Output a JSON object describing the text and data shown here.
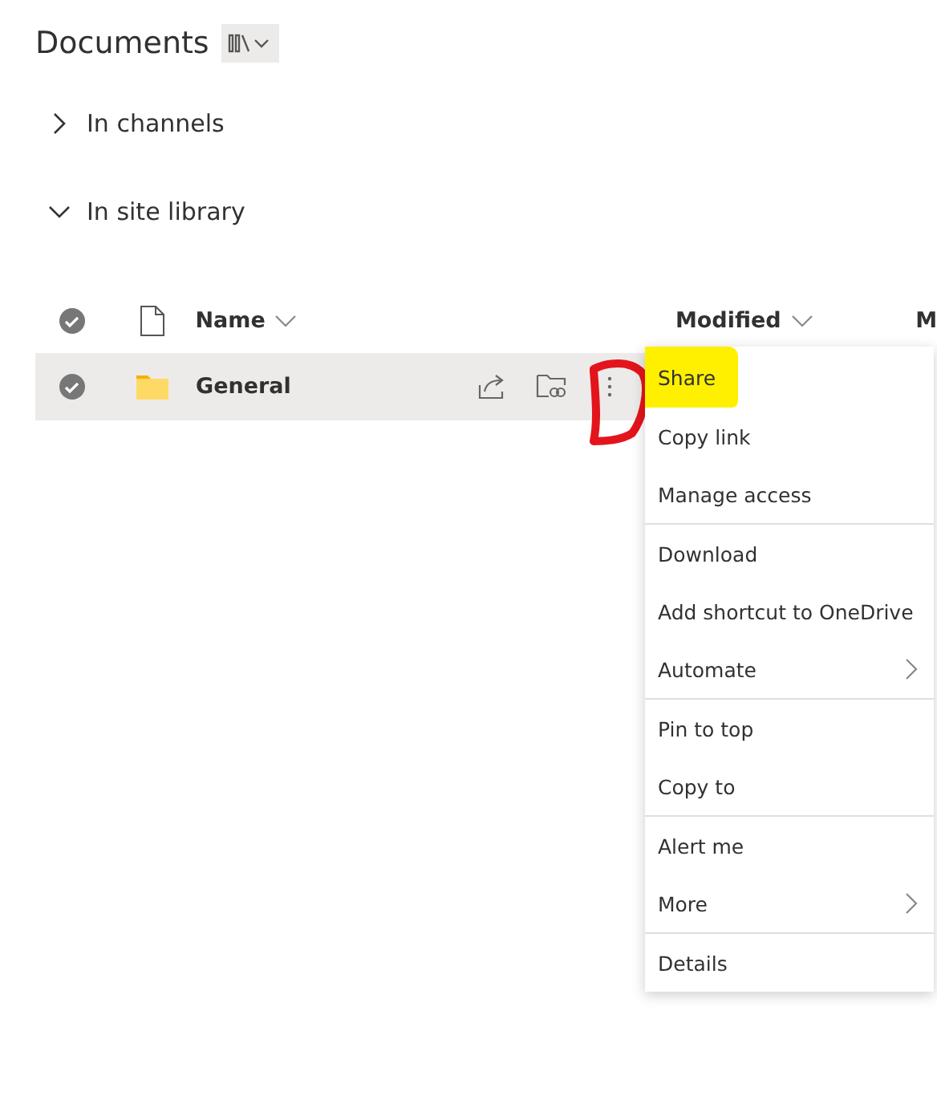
{
  "title": "Documents",
  "sections": [
    {
      "label": "In channels",
      "expanded": false
    },
    {
      "label": "In site library",
      "expanded": true
    }
  ],
  "table": {
    "columns": [
      "Name",
      "Modified",
      "M"
    ],
    "rows": [
      {
        "name": "General",
        "kind": "folder"
      }
    ]
  },
  "context_menu": {
    "groups": [
      [
        {
          "label": "Share",
          "has_submenu": false,
          "highlighted": true
        },
        {
          "label": "Copy link",
          "has_submenu": false,
          "highlighted": false
        },
        {
          "label": "Manage access",
          "has_submenu": false,
          "highlighted": false
        }
      ],
      [
        {
          "label": "Download",
          "has_submenu": false,
          "highlighted": false
        },
        {
          "label": "Add shortcut to OneDrive",
          "has_submenu": false,
          "highlighted": false
        },
        {
          "label": "Automate",
          "has_submenu": true,
          "highlighted": false
        }
      ],
      [
        {
          "label": "Pin to top",
          "has_submenu": false,
          "highlighted": false
        },
        {
          "label": "Copy to",
          "has_submenu": false,
          "highlighted": false
        }
      ],
      [
        {
          "label": "Alert me",
          "has_submenu": false,
          "highlighted": false
        },
        {
          "label": "More",
          "has_submenu": true,
          "highlighted": false
        }
      ],
      [
        {
          "label": "Details",
          "has_submenu": false,
          "highlighted": false
        }
      ]
    ]
  }
}
